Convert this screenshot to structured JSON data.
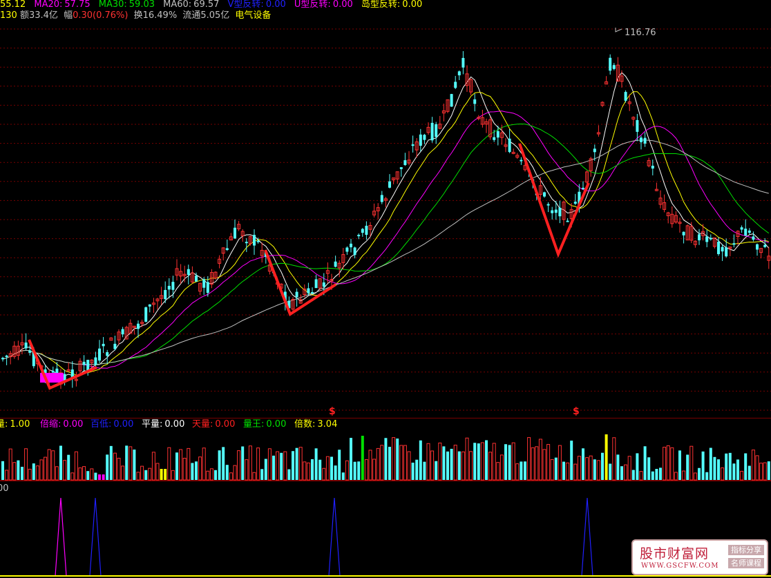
{
  "info_line_1": {
    "price": "55.12",
    "ma20_label": "MA20:",
    "ma20_value": "57.75",
    "ma30_label": "MA30:",
    "ma30_value": "59.03",
    "ma60_label": "MA60:",
    "ma60_value": "69.57",
    "v_reversal_label": "V型反转:",
    "v_reversal_value": "0.00",
    "u_reversal_label": "U型反转:",
    "u_reversal_value": "0.00",
    "island_reversal_label": "岛型反转:",
    "island_reversal_value": "0.00"
  },
  "info_line_2": {
    "prefix": "130",
    "amount": "额33.4亿",
    "change_label": "幅",
    "change": "0.30(0.76%)",
    "turnover": "换16.49%",
    "float": "流通5.05亿",
    "sector": "电气设备"
  },
  "volume_legend": {
    "vol_label": "量:",
    "vol_value": "1.00",
    "shrink_label": "倍缩:",
    "shrink_value": "0.00",
    "low_label": "百低:",
    "low_value": "0.00",
    "flat_label": "平量:",
    "flat_value": "0.00",
    "sky_label": "天量:",
    "sky_value": "0.00",
    "king_label": "量王:",
    "king_value": "0.00",
    "times_label": "倍数:",
    "times_value": "3.04"
  },
  "indicator_label": "00",
  "high_marker": "116.76",
  "signal_marker": "$",
  "colors": {
    "up": "#ff3232",
    "down": "#54ffff",
    "ma5": "#ffffff",
    "ma10": "#ffff00",
    "ma20": "#ff00ff",
    "ma30": "#00e000",
    "ma60": "#c0c0c0",
    "pattern": "#ff2020",
    "u_base": "#ff00ff",
    "grid": "#8b0000"
  },
  "watermark": {
    "name": "股市财富网",
    "url": "WWW.GSCFW.COM",
    "tag1": "指标分享",
    "tag2": "名师课程"
  }
}
